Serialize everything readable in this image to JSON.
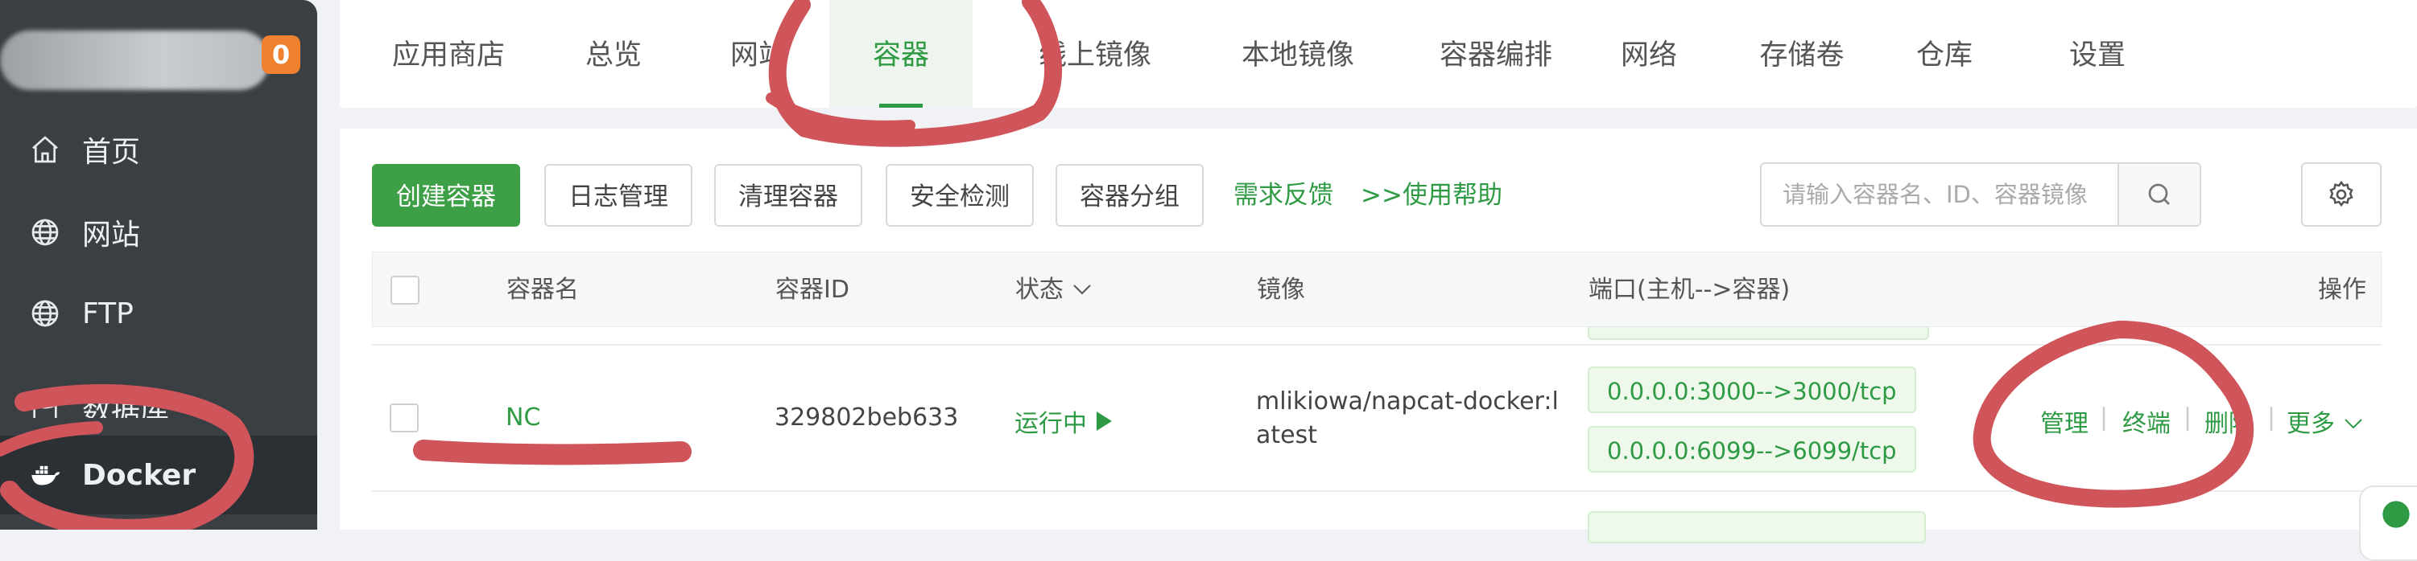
{
  "sidebar": {
    "badge": "0",
    "items": [
      {
        "label": "首页",
        "icon": "home-icon"
      },
      {
        "label": "网站",
        "icon": "globe-icon"
      },
      {
        "label": "FTP",
        "icon": "ftp-globe-icon"
      },
      {
        "label": "数据库",
        "icon": "database-icon"
      },
      {
        "label": "Docker",
        "icon": "docker-icon"
      }
    ]
  },
  "tabs": [
    "应用商店",
    "总览",
    "网站",
    "容器",
    "线上镜像",
    "本地镜像",
    "容器编排",
    "网络",
    "存储卷",
    "仓库",
    "设置"
  ],
  "toolbar": {
    "create": "创建容器",
    "logs": "日志管理",
    "clean": "清理容器",
    "security": "安全检测",
    "group": "容器分组",
    "feedback": "需求反馈",
    "help": ">>使用帮助",
    "search_placeholder": "请输入容器名、ID、容器镜像"
  },
  "table": {
    "headers": {
      "name": "容器名",
      "id": "容器ID",
      "status": "状态",
      "image": "镜像",
      "ports": "端口(主机-->容器)",
      "ops": "操作"
    },
    "rows": [
      {
        "name": "NC",
        "id": "329802beb633",
        "status": "运行中",
        "image_line1": "mlikiowa/napcat-docker:l",
        "image_line2": "atest",
        "ports": [
          "0.0.0.0:3000-->3000/tcp",
          "0.0.0.0:6099-->6099/tcp"
        ],
        "ops": [
          "管理",
          "终端",
          "删除",
          "更多"
        ]
      }
    ]
  },
  "colors": {
    "accent": "#2e9a44",
    "sidebar_bg": "#3a3f44",
    "badge": "#f0812f",
    "annotation": "#d0555a"
  }
}
